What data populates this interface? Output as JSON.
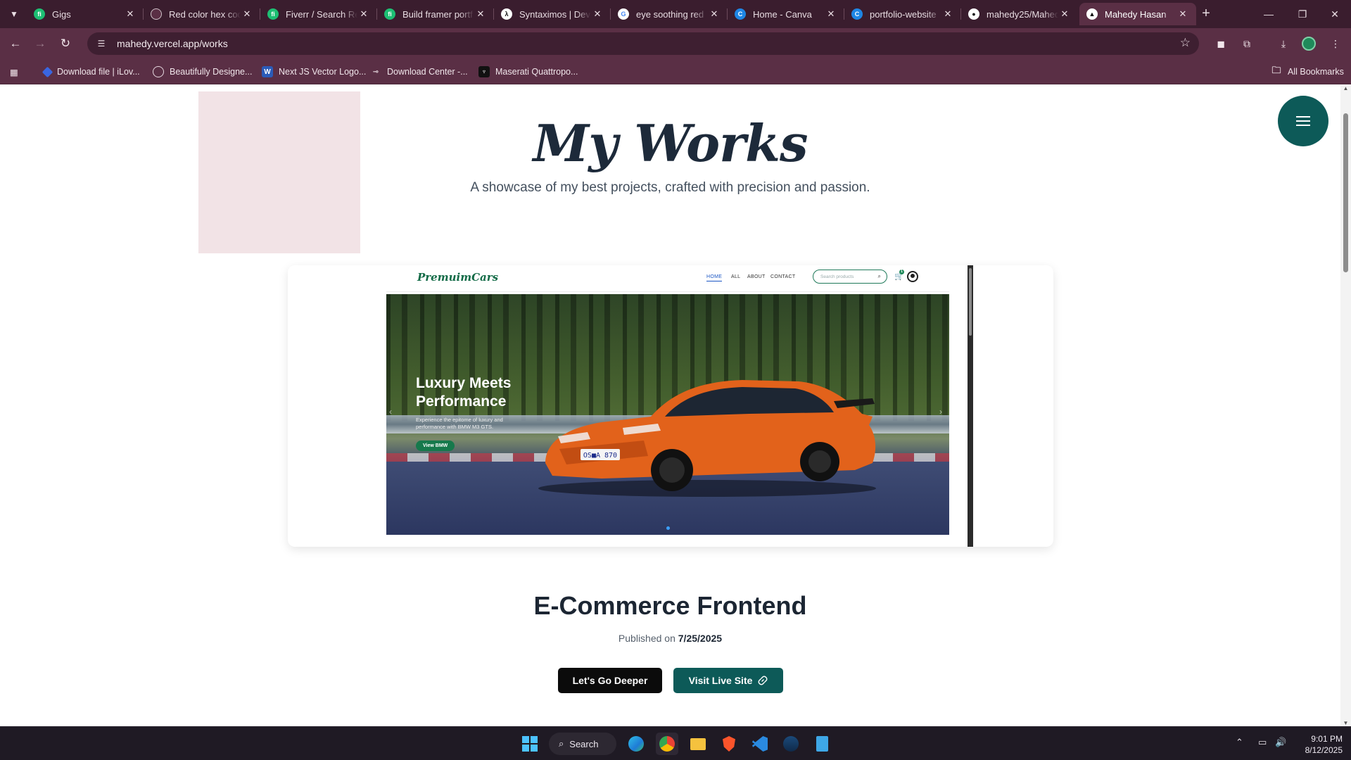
{
  "browser": {
    "tabs": [
      {
        "title": "Gigs",
        "icon": "fiverr-icon",
        "color": "#1dbf73"
      },
      {
        "title": "Red color hex cod",
        "icon": "openai-icon",
        "color": "#cfc3c9"
      },
      {
        "title": "Fiverr / Search Re",
        "icon": "fiverr-icon",
        "color": "#1dbf73"
      },
      {
        "title": "Build framer portf",
        "icon": "fiverr-icon",
        "color": "#1dbf73"
      },
      {
        "title": "Syntaximos | Deve",
        "icon": "syntaximos-icon",
        "color": "#ffffff"
      },
      {
        "title": "eye soothing red",
        "icon": "google-icon",
        "color": "#ffffff"
      },
      {
        "title": "Home - Canva",
        "icon": "canva-icon",
        "color": "#1e86e5"
      },
      {
        "title": "portfolio-website",
        "icon": "canva-icon",
        "color": "#1e86e5"
      },
      {
        "title": "mahedy25/Mahed",
        "icon": "github-icon",
        "color": "#ffffff"
      },
      {
        "title": "Mahedy Hasan",
        "icon": "vercel-icon",
        "color": "#ffffff"
      }
    ],
    "active_tab_index": 9,
    "url": "mahedy.vercel.app/works",
    "bookmarks": [
      {
        "label": "Download file | iLov...",
        "icon": "ilovepdf-icon"
      },
      {
        "label": "Beautifully Designe...",
        "icon": "openai-icon"
      },
      {
        "label": "Next JS Vector Logo...",
        "icon": "word-icon"
      },
      {
        "label": "Download Center -...",
        "icon": "link-icon"
      },
      {
        "label": "Maserati Quattropo...",
        "icon": "maserati-icon"
      }
    ],
    "all_bookmarks_label": "All Bookmarks"
  },
  "page": {
    "title": "My Works",
    "subtitle": "A showcase of my best projects, crafted with precision and passion.",
    "project": {
      "title": "E-Commerce Frontend",
      "published_label": "Published on",
      "published_date": "7/25/2025",
      "primary_button": "Let's Go Deeper",
      "secondary_button": "Visit Live Site"
    },
    "preview": {
      "logo": "PremuimCars",
      "nav": [
        "HOME",
        "ALL",
        "ABOUT",
        "CONTACT"
      ],
      "active_nav": "HOME",
      "search_placeholder": "Search products",
      "cart_count": "1",
      "hero_title": "Luxury Meets Performance",
      "hero_text": "Experience the epitome of luxury and performance with BMW M3 GTS.",
      "hero_button": "View BMW",
      "plate": "OS■A 870"
    },
    "colors": {
      "accent": "#0d5a58",
      "title": "#1d2a3a",
      "pink_box": "#f2e3e6"
    }
  },
  "taskbar": {
    "search_label": "Search",
    "time": "9:01 PM",
    "date": "8/12/2025",
    "apps": [
      "windows-start-icon",
      "edge-icon",
      "chrome-icon",
      "file-explorer-icon",
      "brave-icon",
      "vscode-icon",
      "steam-icon",
      "notepad-icon"
    ]
  }
}
